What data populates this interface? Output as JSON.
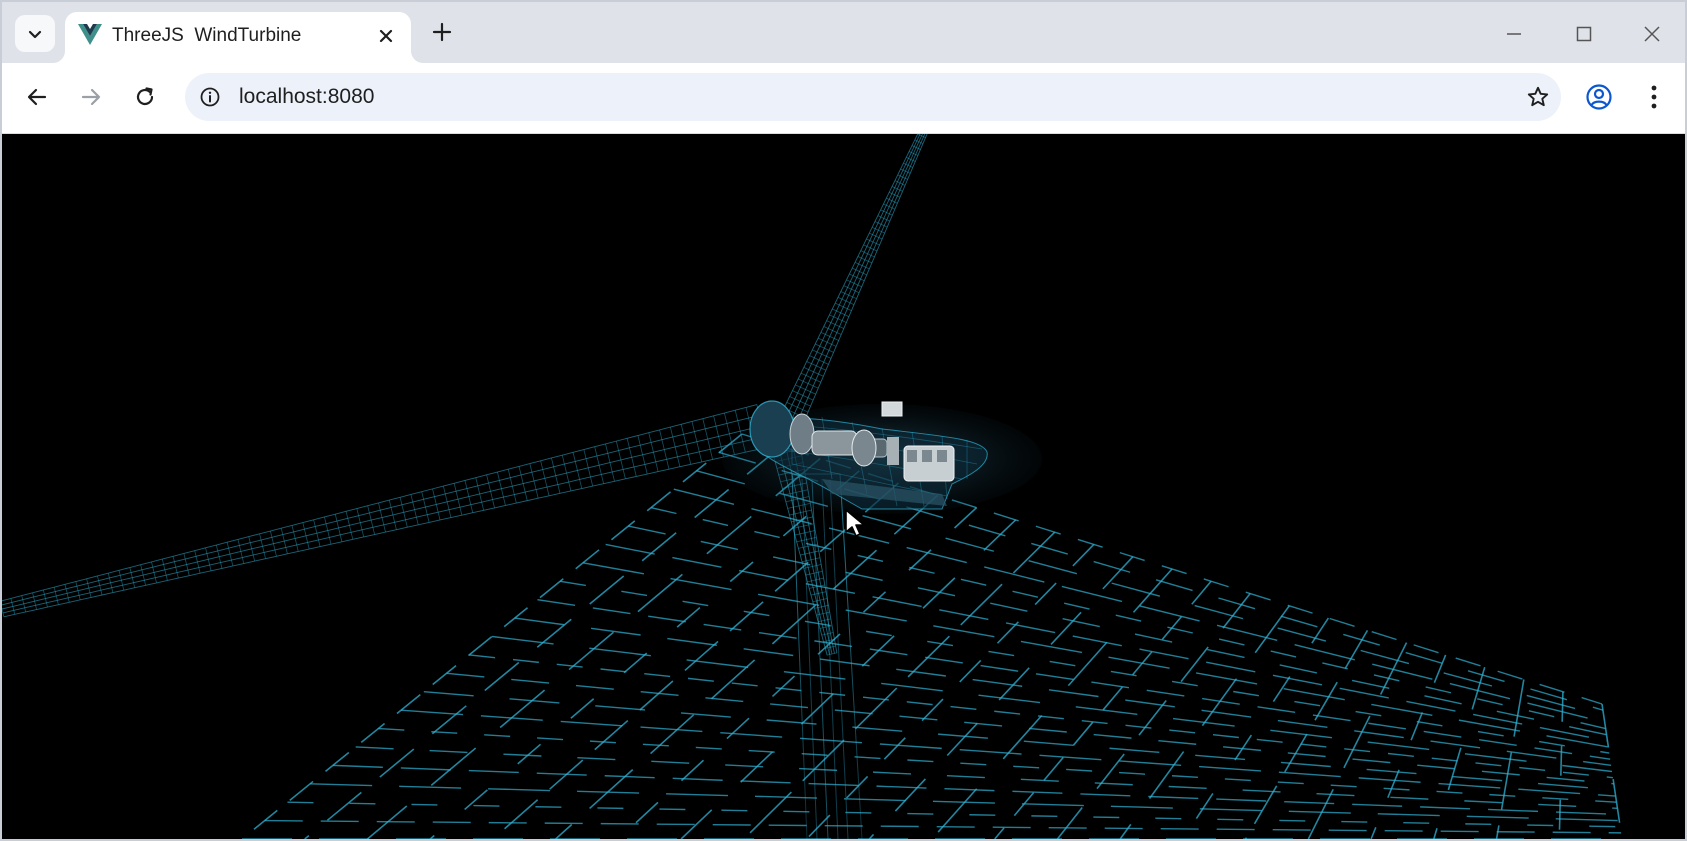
{
  "browser": {
    "tab": {
      "title": "ThreeJS  WindTurbine",
      "favicon_icon": "vue-logo-icon"
    },
    "address_bar": {
      "url": "localhost:8080"
    }
  },
  "colors": {
    "wireframe": "#2fb3d6",
    "background": "#000000",
    "tabstrip": "#dfe3e9",
    "omnibox": "#edf1f9",
    "profile_accent": "#0b57d0"
  }
}
